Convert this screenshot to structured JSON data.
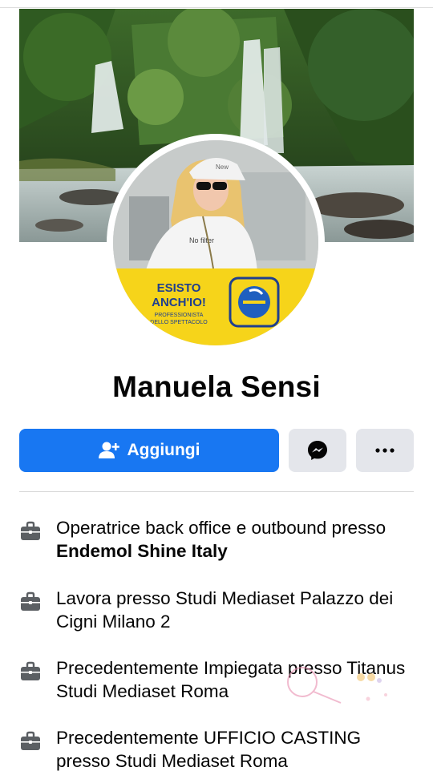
{
  "profile": {
    "name": "Manuela Sensi"
  },
  "avatar_badge": {
    "line1": "ESISTO",
    "line2": "ANCH'IO!",
    "line3": "PROFESSIONISTA",
    "line4": "DELLO SPETTACOLO",
    "shirt_text": "No filter",
    "cap_text": "New"
  },
  "actions": {
    "add_label": "Aggiungi",
    "messenger_icon": "messenger-icon",
    "more_icon": "more-icon"
  },
  "info": [
    {
      "icon": "briefcase-icon",
      "text": "Operatrice back office e outbound presso ",
      "bold": "Endemol Shine Italy"
    },
    {
      "icon": "briefcase-icon",
      "text": "Lavora presso Studi Mediaset Palazzo dei Cigni Milano 2",
      "bold": ""
    },
    {
      "icon": "briefcase-icon",
      "text": "Precedentemente Impiegata presso Titanus Studi Mediaset Roma",
      "bold": ""
    },
    {
      "icon": "briefcase-icon",
      "text": "Precedentemente UFFICIO CASTING presso Studi Mediaset Roma",
      "bold": ""
    }
  ],
  "colors": {
    "primary": "#1877f2",
    "button_gray": "#e4e6eb",
    "badge_yellow": "#f6d41a",
    "icon_gray": "#5b5f63"
  }
}
